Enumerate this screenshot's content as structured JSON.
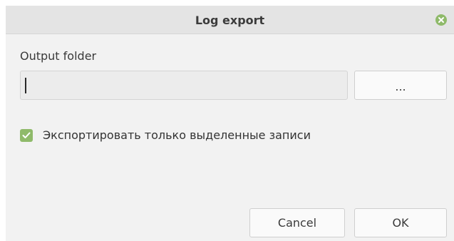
{
  "window": {
    "title": "Log export"
  },
  "form": {
    "output_folder_label": "Output folder",
    "output_folder_value": "",
    "browse_label": "...",
    "export_selected_label": "Экспортировать только выделенные записи",
    "export_selected_checked": true
  },
  "footer": {
    "cancel_label": "Cancel",
    "ok_label": "OK"
  },
  "colors": {
    "accent": "#8fba6a",
    "titlebar": "#e4e4e4",
    "background": "#f2f2f2"
  },
  "icons": {
    "close": "close-icon",
    "checkbox": "checkmark-icon"
  }
}
